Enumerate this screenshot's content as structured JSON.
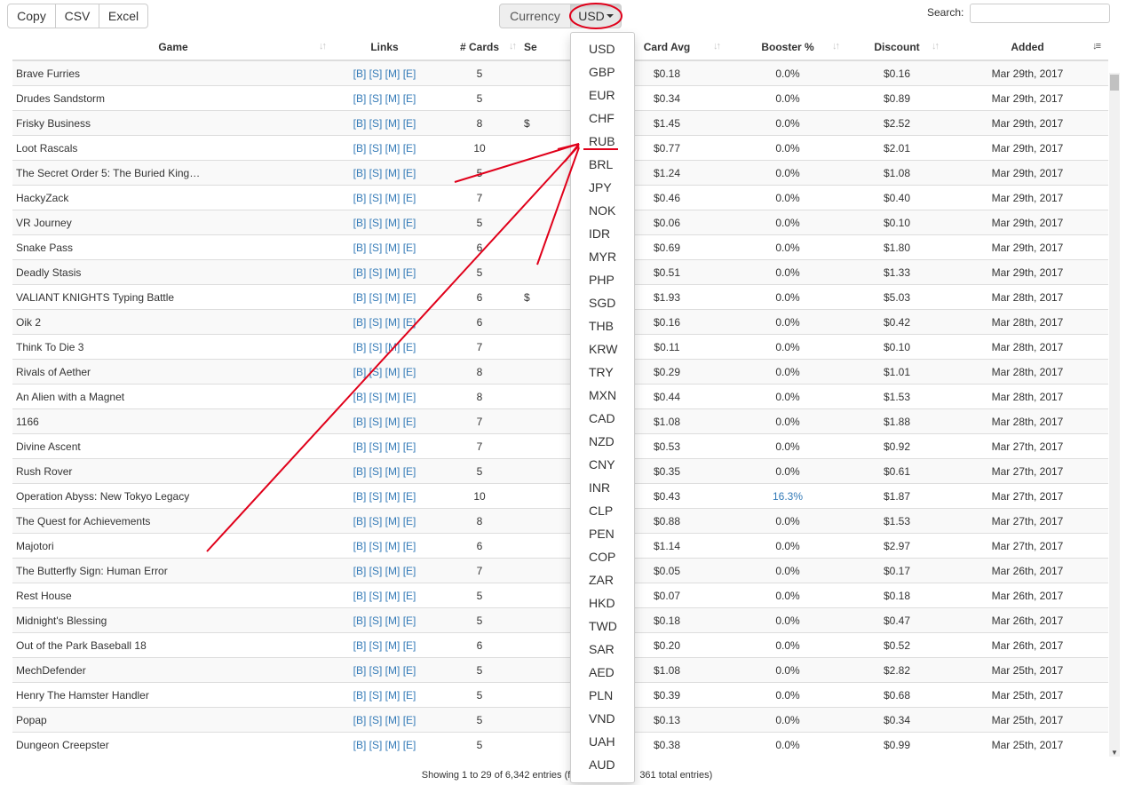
{
  "toolbar": {
    "copy_label": "Copy",
    "csv_label": "CSV",
    "excel_label": "Excel",
    "currency_label": "Currency",
    "currency_selected": "USD",
    "search_label": "Search:",
    "search_value": ""
  },
  "columns": {
    "game": "Game",
    "links": "Links",
    "cards": "# Cards",
    "set": "Se",
    "card_avg": "Card Avg",
    "booster": "Booster %",
    "discount": "Discount",
    "added": "Added"
  },
  "rows": [
    {
      "game": "Brave Furries",
      "cards": "5",
      "set": "",
      "avg": "$0.18",
      "booster": "0.0%",
      "discount": "$0.16",
      "added": "Mar 29th, 2017"
    },
    {
      "game": "Drudes Sandstorm",
      "cards": "5",
      "set": "",
      "avg": "$0.34",
      "booster": "0.0%",
      "discount": "$0.89",
      "added": "Mar 29th, 2017"
    },
    {
      "game": "Frisky Business",
      "cards": "8",
      "set": "$",
      "avg": "$1.45",
      "booster": "0.0%",
      "discount": "$2.52",
      "added": "Mar 29th, 2017"
    },
    {
      "game": "Loot Rascals",
      "cards": "10",
      "set": "",
      "avg": "$0.77",
      "booster": "0.0%",
      "discount": "$2.01",
      "added": "Mar 29th, 2017"
    },
    {
      "game": "The Secret Order 5: The Buried King…",
      "cards": "5",
      "set": "",
      "avg": "$1.24",
      "booster": "0.0%",
      "discount": "$1.08",
      "added": "Mar 29th, 2017"
    },
    {
      "game": "HackyZack",
      "cards": "7",
      "set": "",
      "avg": "$0.46",
      "booster": "0.0%",
      "discount": "$0.40",
      "added": "Mar 29th, 2017"
    },
    {
      "game": "VR Journey",
      "cards": "5",
      "set": "",
      "avg": "$0.06",
      "booster": "0.0%",
      "discount": "$0.10",
      "added": "Mar 29th, 2017"
    },
    {
      "game": "Snake Pass",
      "cards": "6",
      "set": "",
      "avg": "$0.69",
      "booster": "0.0%",
      "discount": "$1.80",
      "added": "Mar 29th, 2017"
    },
    {
      "game": "Deadly Stasis",
      "cards": "5",
      "set": "",
      "avg": "$0.51",
      "booster": "0.0%",
      "discount": "$1.33",
      "added": "Mar 29th, 2017"
    },
    {
      "game": "VALIANT KNIGHTS Typing Battle",
      "cards": "6",
      "set": "$",
      "avg": "$1.93",
      "booster": "0.0%",
      "discount": "$5.03",
      "added": "Mar 28th, 2017"
    },
    {
      "game": "Oik 2",
      "cards": "6",
      "set": "",
      "avg": "$0.16",
      "booster": "0.0%",
      "discount": "$0.42",
      "added": "Mar 28th, 2017"
    },
    {
      "game": "Think To Die 3",
      "cards": "7",
      "set": "",
      "avg": "$0.11",
      "booster": "0.0%",
      "discount": "$0.10",
      "added": "Mar 28th, 2017"
    },
    {
      "game": "Rivals of Aether",
      "cards": "8",
      "set": "",
      "avg": "$0.29",
      "booster": "0.0%",
      "discount": "$1.01",
      "added": "Mar 28th, 2017"
    },
    {
      "game": "An Alien with a Magnet",
      "cards": "8",
      "set": "",
      "avg": "$0.44",
      "booster": "0.0%",
      "discount": "$1.53",
      "added": "Mar 28th, 2017"
    },
    {
      "game": "1166",
      "cards": "7",
      "set": "",
      "avg": "$1.08",
      "booster": "0.0%",
      "discount": "$1.88",
      "added": "Mar 28th, 2017"
    },
    {
      "game": "Divine Ascent",
      "cards": "7",
      "set": "",
      "avg": "$0.53",
      "booster": "0.0%",
      "discount": "$0.92",
      "added": "Mar 27th, 2017"
    },
    {
      "game": "Rush Rover",
      "cards": "5",
      "set": "",
      "avg": "$0.35",
      "booster": "0.0%",
      "discount": "$0.61",
      "added": "Mar 27th, 2017"
    },
    {
      "game": "Operation Abyss: New Tokyo Legacy",
      "cards": "10",
      "set": "",
      "avg": "$0.43",
      "booster": "16.3%",
      "discount": "$1.87",
      "added": "Mar 27th, 2017"
    },
    {
      "game": "The Quest for Achievements",
      "cards": "8",
      "set": "",
      "avg": "$0.88",
      "booster": "0.0%",
      "discount": "$1.53",
      "added": "Mar 27th, 2017"
    },
    {
      "game": "Majotori",
      "cards": "6",
      "set": "",
      "avg": "$1.14",
      "booster": "0.0%",
      "discount": "$2.97",
      "added": "Mar 27th, 2017"
    },
    {
      "game": "The Butterfly Sign: Human Error",
      "cards": "7",
      "set": "",
      "avg": "$0.05",
      "booster": "0.0%",
      "discount": "$0.17",
      "added": "Mar 26th, 2017"
    },
    {
      "game": "Rest House",
      "cards": "5",
      "set": "",
      "avg": "$0.07",
      "booster": "0.0%",
      "discount": "$0.18",
      "added": "Mar 26th, 2017"
    },
    {
      "game": "Midnight's Blessing",
      "cards": "5",
      "set": "",
      "avg": "$0.18",
      "booster": "0.0%",
      "discount": "$0.47",
      "added": "Mar 26th, 2017"
    },
    {
      "game": "Out of the Park Baseball 18",
      "cards": "6",
      "set": "",
      "avg": "$0.20",
      "booster": "0.0%",
      "discount": "$0.52",
      "added": "Mar 26th, 2017"
    },
    {
      "game": "MechDefender",
      "cards": "5",
      "set": "",
      "avg": "$1.08",
      "booster": "0.0%",
      "discount": "$2.82",
      "added": "Mar 25th, 2017"
    },
    {
      "game": "Henry The Hamster Handler",
      "cards": "5",
      "set": "",
      "avg": "$0.39",
      "booster": "0.0%",
      "discount": "$0.68",
      "added": "Mar 25th, 2017"
    },
    {
      "game": "Popap",
      "cards": "5",
      "set": "",
      "avg": "$0.13",
      "booster": "0.0%",
      "discount": "$0.34",
      "added": "Mar 25th, 2017"
    },
    {
      "game": "Dungeon Creepster",
      "cards": "5",
      "set": "",
      "avg": "$0.38",
      "booster": "0.0%",
      "discount": "$0.99",
      "added": "Mar 25th, 2017"
    }
  ],
  "links": [
    "[B]",
    "[S]",
    "[M]",
    "[E]"
  ],
  "currency_options": [
    "USD",
    "GBP",
    "EUR",
    "CHF",
    "RUB",
    "BRL",
    "JPY",
    "NOK",
    "IDR",
    "MYR",
    "PHP",
    "SGD",
    "THB",
    "KRW",
    "TRY",
    "MXN",
    "CAD",
    "NZD",
    "CNY",
    "INR",
    "CLP",
    "PEN",
    "COP",
    "ZAR",
    "HKD",
    "TWD",
    "SAR",
    "AED",
    "PLN",
    "VND",
    "UAH",
    "AUD"
  ],
  "info": {
    "left": "Showing 1 to 29 of 6,342 entries (f",
    "right": "361 total entries)"
  },
  "colors": {
    "annotation": "#e0001a",
    "link": "#337ab7"
  }
}
